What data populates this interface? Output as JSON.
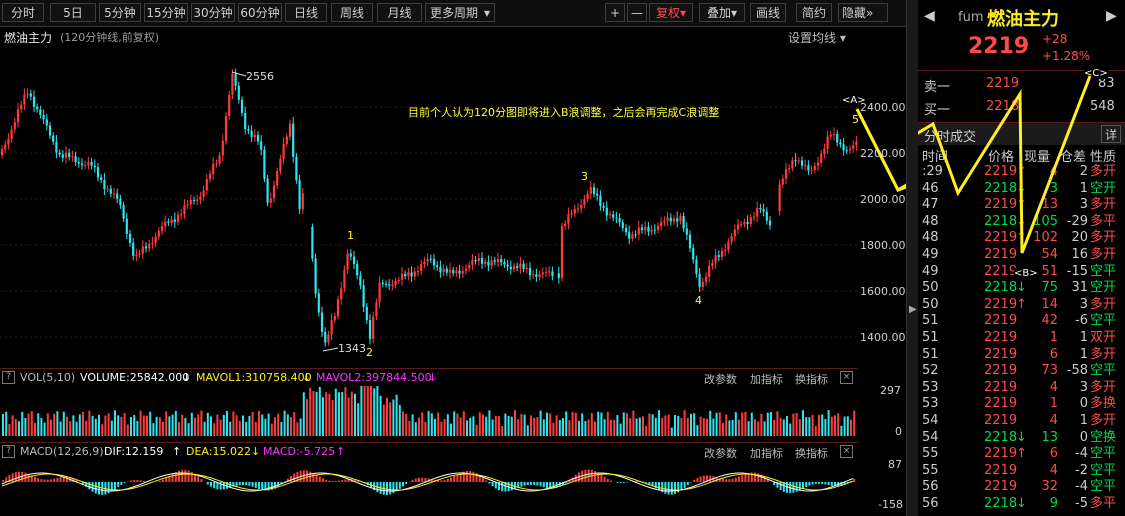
{
  "toolbar": {
    "periods": [
      "分时",
      "5日",
      "5分钟",
      "15分钟",
      "30分钟",
      "60分钟",
      "日线",
      "周线",
      "月线",
      "更多周期"
    ],
    "tools": [
      "+",
      "—",
      "复权",
      "叠加",
      "画线",
      "简约",
      "隐藏"
    ]
  },
  "chart_header": {
    "title": "燃油主力",
    "subtitle": "(120分钟线,前复权)",
    "ma_setting": "设置均线"
  },
  "annotation": "目前个人认为120分图即将进入B浪调整，之后会再完成C浪调整",
  "price_axis": [
    "2400.00",
    "2200.00",
    "2000.00",
    "1800.00",
    "1600.00",
    "1400.00"
  ],
  "price_marks": {
    "high": "2556",
    "low": "1343"
  },
  "wave_labels": {
    "w1": "1",
    "w2": "2",
    "w3": "3",
    "w4": "4",
    "w5": "5",
    "A": "<A>",
    "B": "<B>",
    "C": "<C>"
  },
  "vol_panel": {
    "name": "VOL(5,10)",
    "volume": "VOLUME:25842.000",
    "mavol1": "MAVOL1:310758.400",
    "mavol2": "MAVOL2:397844.500",
    "axis_top": "297",
    "axis_bottom": "0",
    "actions": [
      "改参数",
      "加指标",
      "换指标"
    ]
  },
  "macd_panel": {
    "name": "MACD(12,26,9)",
    "dif": "DIF:12.159",
    "dea": "DEA:15.022",
    "macd": "MACD:-5.725",
    "axis_top": "87",
    "axis_bottom": "-158",
    "actions": [
      "改参数",
      "加指标",
      "换指标"
    ]
  },
  "quote": {
    "code": "fum",
    "name": "燃油主力",
    "price": "2219",
    "change": "+28",
    "change_pct": "+1.28%",
    "sell_label": "卖一",
    "sell_price": "2219",
    "sell_vol": "83",
    "buy_label": "买一",
    "buy_price": "2218",
    "buy_vol": "548",
    "ticks_title": "分时成交",
    "detail_btn": "详",
    "ticks_header": [
      "时间",
      "价格",
      "现量",
      "仓差",
      "性质"
    ]
  },
  "ticks": [
    {
      "t": ":29",
      "p": "2219",
      "d": "↑",
      "q": "4",
      "c": "2",
      "n": "多开",
      "col": "red"
    },
    {
      "t": "46",
      "p": "2218",
      "d": "↓",
      "q": "3",
      "c": "1",
      "n": "空开",
      "col": "green"
    },
    {
      "t": "47",
      "p": "2219",
      "d": "↑",
      "q": "13",
      "c": "3",
      "n": "多开",
      "col": "red"
    },
    {
      "t": "48",
      "p": "2218",
      "d": "↓",
      "q": "105",
      "c": "-29",
      "n": "多平",
      "col": "green"
    },
    {
      "t": "48",
      "p": "2219",
      "d": "↑",
      "q": "102",
      "c": "20",
      "n": "多开",
      "col": "red"
    },
    {
      "t": "49",
      "p": "2219",
      "d": "",
      "q": "54",
      "c": "16",
      "n": "多开",
      "col": "red"
    },
    {
      "t": "49",
      "p": "2219",
      "d": "",
      "q": "51",
      "c": "-15",
      "n": "空平",
      "col": "red"
    },
    {
      "t": "50",
      "p": "2218",
      "d": "↓",
      "q": "75",
      "c": "31",
      "n": "空开",
      "col": "green"
    },
    {
      "t": "50",
      "p": "2219",
      "d": "↑",
      "q": "14",
      "c": "3",
      "n": "多开",
      "col": "red"
    },
    {
      "t": "51",
      "p": "2219",
      "d": "",
      "q": "42",
      "c": "-6",
      "n": "空平",
      "col": "red"
    },
    {
      "t": "51",
      "p": "2219",
      "d": "",
      "q": "1",
      "c": "1",
      "n": "双开",
      "col": "red"
    },
    {
      "t": "51",
      "p": "2219",
      "d": "",
      "q": "6",
      "c": "1",
      "n": "多开",
      "col": "red"
    },
    {
      "t": "52",
      "p": "2219",
      "d": "",
      "q": "73",
      "c": "-58",
      "n": "空平",
      "col": "red"
    },
    {
      "t": "53",
      "p": "2219",
      "d": "",
      "q": "4",
      "c": "3",
      "n": "多开",
      "col": "red"
    },
    {
      "t": "53",
      "p": "2219",
      "d": "",
      "q": "1",
      "c": "0",
      "n": "多换",
      "col": "red"
    },
    {
      "t": "54",
      "p": "2219",
      "d": "",
      "q": "4",
      "c": "1",
      "n": "多开",
      "col": "red"
    },
    {
      "t": "54",
      "p": "2218",
      "d": "↓",
      "q": "13",
      "c": "0",
      "n": "空换",
      "col": "green"
    },
    {
      "t": "55",
      "p": "2219",
      "d": "↑",
      "q": "6",
      "c": "-4",
      "n": "空平",
      "col": "red"
    },
    {
      "t": "55",
      "p": "2219",
      "d": "",
      "q": "4",
      "c": "-2",
      "n": "空平",
      "col": "red"
    },
    {
      "t": "56",
      "p": "2219",
      "d": "",
      "q": "32",
      "c": "-4",
      "n": "空平",
      "col": "red"
    },
    {
      "t": "56",
      "p": "2218",
      "d": "↓",
      "q": "9",
      "c": "-5",
      "n": "多平",
      "col": "green"
    }
  ]
}
